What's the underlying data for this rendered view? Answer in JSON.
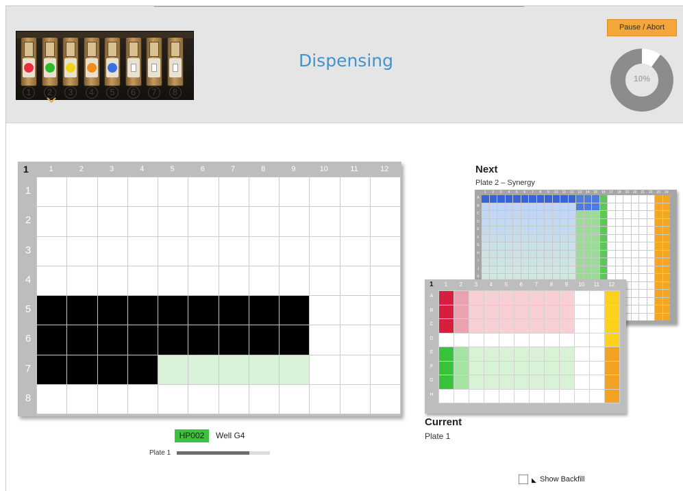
{
  "header": {
    "title": "Dispensing",
    "pause_label": "Pause / Abort",
    "progress_label": "10%",
    "progress_fraction": 0.1,
    "selected_channel": "2"
  },
  "dispenser": {
    "channels": [
      {
        "number": "1",
        "tip": "dot",
        "color": "#e8303c"
      },
      {
        "number": "2",
        "tip": "dot",
        "color": "#2fba2f"
      },
      {
        "number": "3",
        "tip": "dot",
        "color": "#f2d21a"
      },
      {
        "number": "4",
        "tip": "dot",
        "color": "#f08c1a"
      },
      {
        "number": "5",
        "tip": "dot",
        "color": "#3a70e0"
      },
      {
        "number": "6",
        "tip": "square",
        "color": "#ffffff"
      },
      {
        "number": "7",
        "tip": "square",
        "color": "#ffffff"
      },
      {
        "number": "8",
        "tip": "square",
        "color": "#ffffff"
      }
    ]
  },
  "main_plate": {
    "corner": "1",
    "columns": [
      "1",
      "2",
      "3",
      "4",
      "5",
      "6",
      "7",
      "8",
      "9",
      "10",
      "11",
      "12"
    ],
    "rows": [
      "1",
      "2",
      "3",
      "4",
      "5",
      "6",
      "7",
      "8"
    ],
    "black_wells": "rows 5-6 cols 1-9, row 7 cols 1-4",
    "green_wells": "row 7 cols 5-9",
    "colors": {
      "dispensed": "#000000",
      "pending": "#daf2d9",
      "empty": "#ffffff"
    }
  },
  "status": {
    "plate_id": "HP002",
    "well": "Well G4",
    "plate_label": "Plate 1",
    "plate_progress": 0.78
  },
  "next_plate": {
    "title": "Next",
    "subtitle": "Plate 2 – Synergy",
    "columns": [
      "1",
      "2",
      "3",
      "4",
      "5",
      "6",
      "7",
      "8",
      "9",
      "10",
      "11",
      "12",
      "13",
      "14",
      "15",
      "16",
      "17",
      "18",
      "19",
      "20",
      "21",
      "22",
      "23",
      "24"
    ],
    "rows": [
      "A",
      "B",
      "C",
      "D",
      "E",
      "F",
      "G",
      "H",
      "I",
      "J",
      "K",
      "L",
      "M",
      "N",
      "O",
      "P"
    ]
  },
  "current_plate": {
    "title": "Current",
    "subtitle": "Plate 1",
    "corner": "1",
    "columns": [
      "1",
      "2",
      "3",
      "4",
      "5",
      "6",
      "7",
      "8",
      "9",
      "10",
      "11",
      "12"
    ],
    "rows": [
      "A",
      "B",
      "C",
      "D",
      "E",
      "F",
      "G",
      "H"
    ]
  },
  "backfill": {
    "label": "Show Backfill",
    "checked": false
  }
}
